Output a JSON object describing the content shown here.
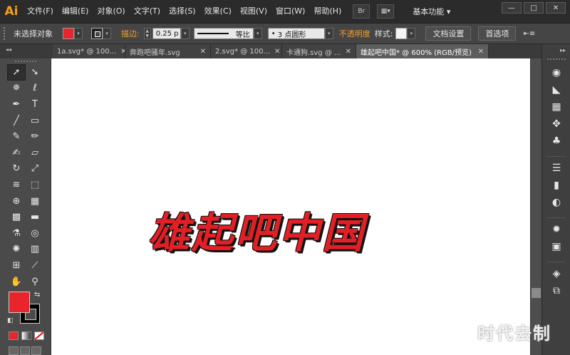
{
  "app": {
    "logo": "Ai",
    "workspace": "基本功能"
  },
  "menu": [
    "文件(F)",
    "编辑(E)",
    "对象(O)",
    "文字(T)",
    "选择(S)",
    "效果(C)",
    "视图(V)",
    "窗口(W)",
    "帮助(H)"
  ],
  "menubar_icons": [
    "bridge-icon",
    "arrange-documents-icon"
  ],
  "window_buttons": {
    "minimize": "—",
    "maximize": "□",
    "close": "✕"
  },
  "control": {
    "selection_status": "未选择对象",
    "fill_color": "#e8252b",
    "stroke_label": "描边:",
    "stroke_weight": "0.25 p",
    "stroke_profile": "等比",
    "brush": "3 点圆形",
    "opacity_label": "不透明度",
    "style_label": "样式:",
    "doc_setup": "文档设置",
    "preferences": "首选项"
  },
  "tabs": [
    {
      "label": "1a.svg* @ 100...",
      "close": "✕",
      "active": false
    },
    {
      "label": "奔跑吧骚年.svg",
      "close": "✕",
      "active": false
    },
    {
      "label": "2.svg* @ 100...",
      "close": "✕",
      "active": false
    },
    {
      "label": "卡通狗.svg @ ...",
      "close": "✕",
      "active": false
    },
    {
      "label": "雄起吧中国* @ 600% (RGB/预览)",
      "close": "✕",
      "active": true
    }
  ],
  "tools": [
    {
      "name": "selection-tool-icon",
      "glyph": "➚"
    },
    {
      "name": "direct-selection-tool-icon",
      "glyph": "➘"
    },
    {
      "name": "magic-wand-tool-icon",
      "glyph": "✵"
    },
    {
      "name": "lasso-tool-icon",
      "glyph": "ℓ"
    },
    {
      "name": "pen-tool-icon",
      "glyph": "✒"
    },
    {
      "name": "type-tool-icon",
      "glyph": "T"
    },
    {
      "name": "line-tool-icon",
      "glyph": "╱"
    },
    {
      "name": "rectangle-tool-icon",
      "glyph": "▭"
    },
    {
      "name": "paintbrush-tool-icon",
      "glyph": "✎"
    },
    {
      "name": "pencil-tool-icon",
      "glyph": "✏"
    },
    {
      "name": "blob-brush-tool-icon",
      "glyph": "✍"
    },
    {
      "name": "eraser-tool-icon",
      "glyph": "▱"
    },
    {
      "name": "rotate-tool-icon",
      "glyph": "↻"
    },
    {
      "name": "scale-tool-icon",
      "glyph": "⤢"
    },
    {
      "name": "warp-tool-icon",
      "glyph": "≋"
    },
    {
      "name": "free-transform-tool-icon",
      "glyph": "⬚"
    },
    {
      "name": "shape-builder-tool-icon",
      "glyph": "⊕"
    },
    {
      "name": "perspective-grid-tool-icon",
      "glyph": "▦"
    },
    {
      "name": "mesh-tool-icon",
      "glyph": "▩"
    },
    {
      "name": "gradient-tool-icon",
      "glyph": "▬"
    },
    {
      "name": "eyedropper-tool-icon",
      "glyph": "⚗"
    },
    {
      "name": "blend-tool-icon",
      "glyph": "◎"
    },
    {
      "name": "symbol-sprayer-tool-icon",
      "glyph": "✺"
    },
    {
      "name": "column-graph-tool-icon",
      "glyph": "▥"
    },
    {
      "name": "artboard-tool-icon",
      "glyph": "⊞"
    },
    {
      "name": "slice-tool-icon",
      "glyph": "⟋"
    },
    {
      "name": "hand-tool-icon",
      "glyph": "✋"
    },
    {
      "name": "zoom-tool-icon",
      "glyph": "⚲"
    }
  ],
  "swatches": {
    "fill": "#e8252b",
    "stroke": "#000000"
  },
  "canvas": {
    "artwork_text": "雄起吧中国",
    "artwork_color": "#e31f26"
  },
  "dock_icons": [
    {
      "name": "color-icon",
      "glyph": "◉"
    },
    {
      "name": "color-guide-icon",
      "glyph": "◣"
    },
    {
      "name": "swatches-icon",
      "glyph": "▦"
    },
    {
      "name": "brushes-icon",
      "glyph": "✥"
    },
    {
      "name": "symbols-icon",
      "glyph": "♣"
    },
    {
      "name": "stroke-icon",
      "glyph": "☰"
    },
    {
      "name": "gradient-icon",
      "glyph": "▮"
    },
    {
      "name": "transparency-icon",
      "glyph": "◐"
    },
    {
      "name": "appearance-icon",
      "glyph": "✹"
    },
    {
      "name": "graphic-styles-icon",
      "glyph": "▣"
    },
    {
      "name": "layers-icon",
      "glyph": "◈"
    },
    {
      "name": "artboards-icon",
      "glyph": "⧉"
    }
  ],
  "watermark": "时代去制"
}
